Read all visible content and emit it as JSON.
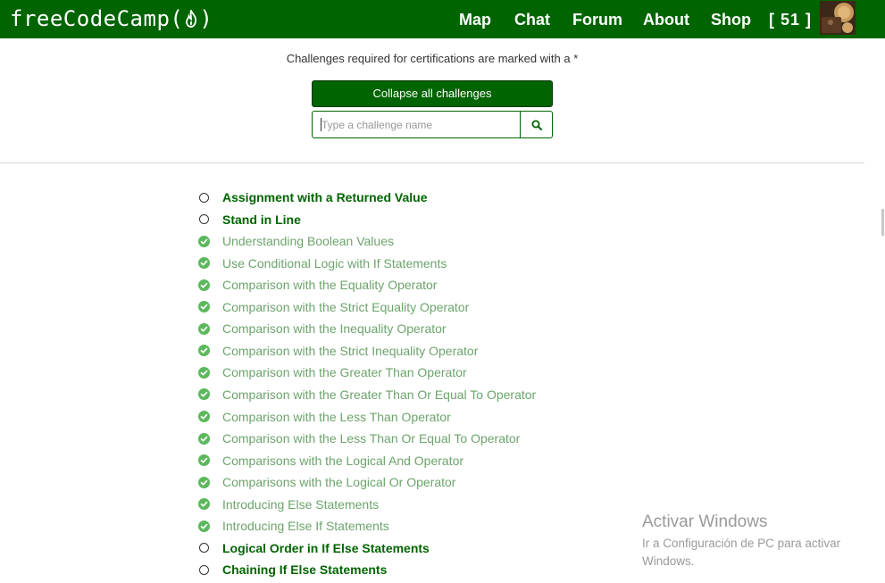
{
  "navbar": {
    "logo_text_left": "freeCodeCamp(",
    "logo_text_right": ")",
    "links": [
      "Map",
      "Chat",
      "Forum",
      "About",
      "Shop"
    ],
    "points": "[ 51 ]",
    "logo_icon": "flame-icon",
    "background": "#006400"
  },
  "header": {
    "note": "Challenges required for certifications are marked with a *",
    "collapse_label": "Collapse all challenges",
    "search_placeholder": "Type a challenge name",
    "search_icon": "search-icon"
  },
  "challenges": [
    {
      "title": "Assignment with a Returned Value",
      "completed": false
    },
    {
      "title": "Stand in Line",
      "completed": false
    },
    {
      "title": "Understanding Boolean Values",
      "completed": true
    },
    {
      "title": "Use Conditional Logic with If Statements",
      "completed": true
    },
    {
      "title": "Comparison with the Equality Operator",
      "completed": true
    },
    {
      "title": "Comparison with the Strict Equality Operator",
      "completed": true
    },
    {
      "title": "Comparison with the Inequality Operator",
      "completed": true
    },
    {
      "title": "Comparison with the Strict Inequality Operator",
      "completed": true
    },
    {
      "title": "Comparison with the Greater Than Operator",
      "completed": true
    },
    {
      "title": "Comparison with the Greater Than Or Equal To Operator",
      "completed": true
    },
    {
      "title": "Comparison with the Less Than Operator",
      "completed": true
    },
    {
      "title": "Comparison with the Less Than Or Equal To Operator",
      "completed": true
    },
    {
      "title": "Comparisons with the Logical And Operator",
      "completed": true
    },
    {
      "title": "Comparisons with the Logical Or Operator",
      "completed": true
    },
    {
      "title": "Introducing Else Statements",
      "completed": true
    },
    {
      "title": "Introducing Else If Statements",
      "completed": true
    },
    {
      "title": "Logical Order in If Else Statements",
      "completed": false
    },
    {
      "title": "Chaining If Else Statements",
      "completed": false
    }
  ],
  "watermark": {
    "title": "Activar Windows",
    "subtitle": "Ir a Configuración de PC para activar Windows."
  },
  "colors": {
    "completed_title": "#6ca46c",
    "todo_title": "#006400",
    "check": "#5cb85c"
  }
}
